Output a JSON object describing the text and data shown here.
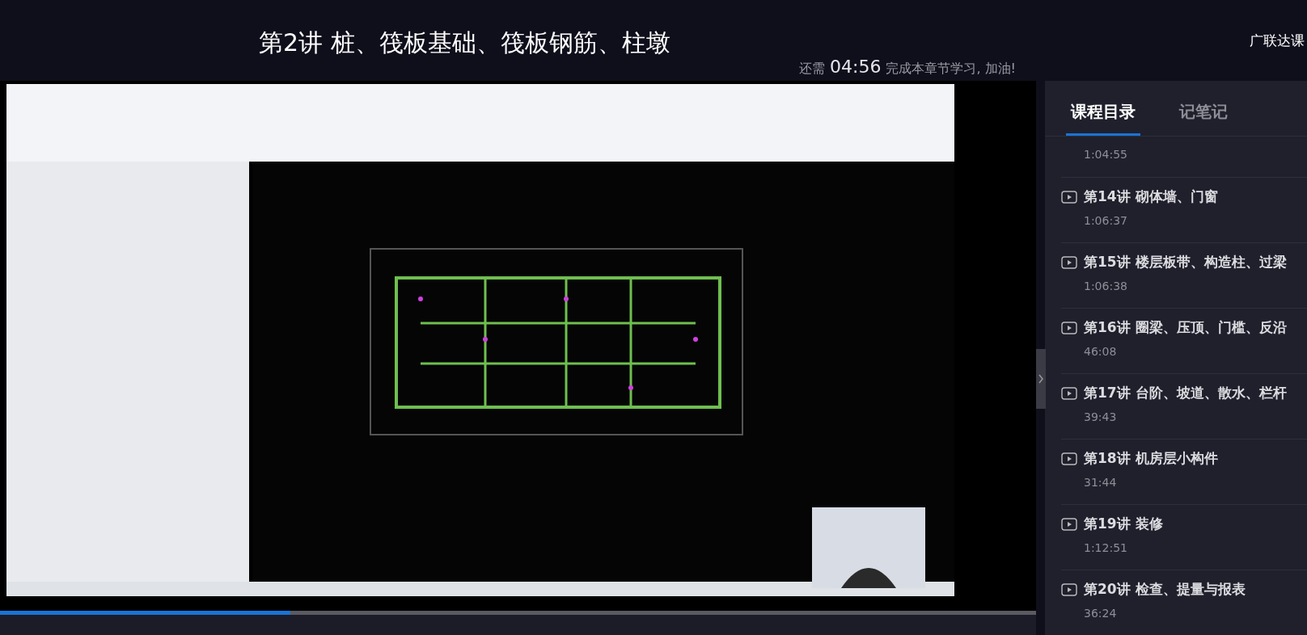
{
  "header": {
    "title": "第2讲 桩、筏板基础、筏板钢筋、柱墩",
    "brand": "广联达课",
    "timer": {
      "prefix": "还需",
      "time": "04:56",
      "suffix": "完成本章节学习, 加油!"
    }
  },
  "video": {
    "kind": "picture",
    "progress": {
      "level": 0.28
    }
  },
  "sidebar": {
    "tabs": [
      {
        "label": "课程目录",
        "selected": true
      },
      {
        "label": "记笔记",
        "selected": false
      }
    ],
    "lessons": [
      {
        "duration": "1:04:55"
      },
      {
        "title": "第14讲 砌体墙、门窗",
        "duration": "1:06:37"
      },
      {
        "title": "第15讲 楼层板带、构造柱、过梁",
        "duration": "1:06:38"
      },
      {
        "title": "第16讲 圈梁、压顶、门槛、反沿",
        "duration": "46:08"
      },
      {
        "title": "第17讲 台阶、坡道、散水、栏杆",
        "duration": "39:43"
      },
      {
        "title": "第18讲 机房层小构件",
        "duration": "31:44"
      },
      {
        "title": "第19讲 装修",
        "duration": "1:12:51"
      },
      {
        "title": "第20讲 检查、提量与报表",
        "duration": "36:24"
      }
    ]
  }
}
